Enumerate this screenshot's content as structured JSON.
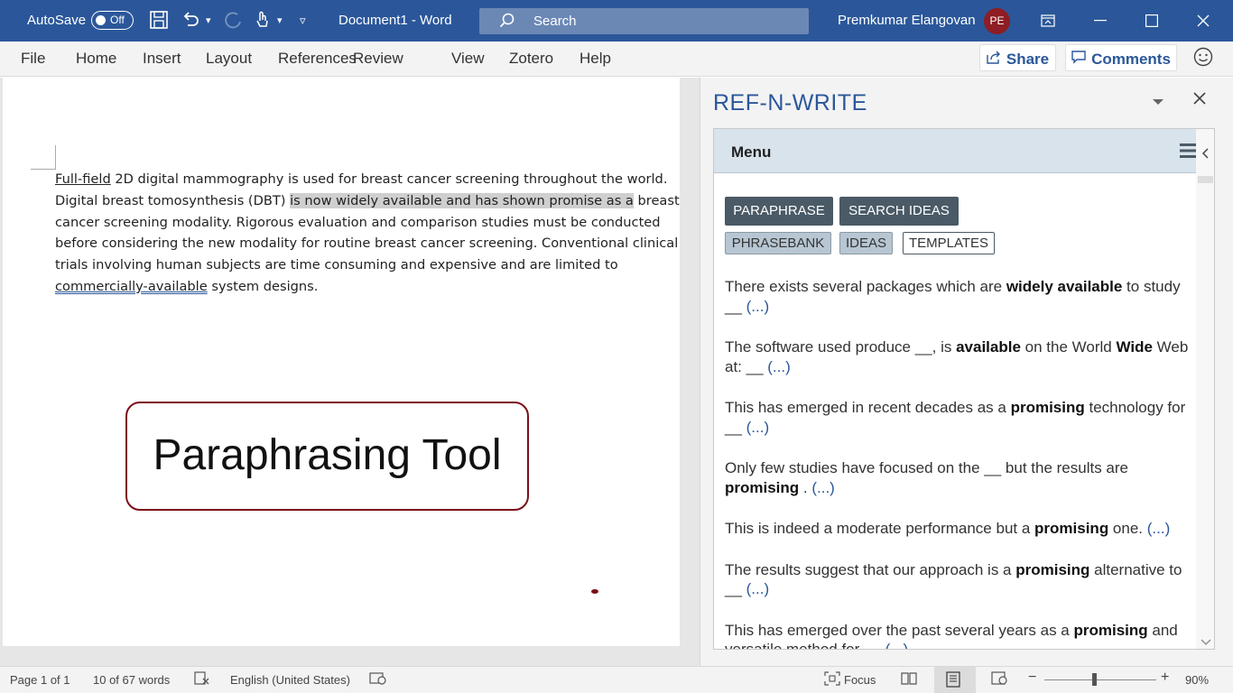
{
  "titlebar": {
    "autosave_label": "AutoSave",
    "autosave_state": "Off",
    "document_title": "Document1  -  Word",
    "search_placeholder": "Search",
    "user_name": "Premkumar Elangovan",
    "user_initials": "PE",
    "accent_color": "#2b579a"
  },
  "ribbon": {
    "tabs": [
      "File",
      "Home",
      "Insert",
      "Layout",
      "References",
      "Review",
      "View",
      "Zotero",
      "Help"
    ],
    "share_label": "Share",
    "comments_label": "Comments"
  },
  "document": {
    "p1_link1": "Full-field",
    "p1_text1": " 2D digital mammography is used for breast cancer screening throughout the world. Digital breast tomosynthesis (DBT) ",
    "p1_highlight": "is now widely available and has shown promise as a",
    "p1_text2": " breast cancer screening modality. Rigorous evaluation and comparison studies must be conducted before considering the new modality for routine breast cancer screening. Conventional clinical trials involving human subjects are time consuming and expensive and are limited to ",
    "p1_link2": "commercially-available",
    "p1_text3": " system designs.",
    "callout_text": "Paraphrasing Tool"
  },
  "pane": {
    "title": "REF-N-WRITE",
    "menu_label": "Menu",
    "buttons": [
      "PARAPHRASE",
      "SEARCH IDEAS"
    ],
    "tags": [
      "PHRASEBANK",
      "IDEAS",
      "TEMPLATES"
    ],
    "results": [
      {
        "parts": [
          [
            "There exists several packages which are ",
            false
          ],
          [
            "widely available",
            true
          ],
          [
            " to study __ ",
            false
          ],
          [
            "(...)",
            "more"
          ]
        ]
      },
      {
        "parts": [
          [
            "The software used produce __, is ",
            false
          ],
          [
            "available",
            true
          ],
          [
            " on the World ",
            false
          ],
          [
            "Wide",
            true
          ],
          [
            " Web at: __ ",
            false
          ],
          [
            "(...)",
            "more"
          ]
        ]
      },
      {
        "parts": [
          [
            "This has emerged in recent decades as a ",
            false
          ],
          [
            "promising",
            true
          ],
          [
            " technology for __ ",
            false
          ],
          [
            "(...)",
            "more"
          ]
        ]
      },
      {
        "parts": [
          [
            "Only few studies have focused on the __ but the results are ",
            false
          ],
          [
            "promising",
            true
          ],
          [
            " . ",
            false
          ],
          [
            "(...)",
            "more"
          ]
        ]
      },
      {
        "parts": [
          [
            "This is indeed a moderate performance but a ",
            false
          ],
          [
            "promising",
            true
          ],
          [
            " one. ",
            false
          ],
          [
            "(...)",
            "more"
          ]
        ]
      },
      {
        "parts": [
          [
            "The results suggest that our approach is a ",
            false
          ],
          [
            "promising",
            true
          ],
          [
            " alternative to __ ",
            false
          ],
          [
            "(...)",
            "more"
          ]
        ]
      },
      {
        "parts": [
          [
            "This has emerged over the past several years as a ",
            false
          ],
          [
            "promising",
            true
          ],
          [
            " and versatile method for __ ",
            false
          ],
          [
            "(...)",
            "more"
          ]
        ]
      }
    ]
  },
  "statusbar": {
    "page": "Page 1 of 1",
    "words": "10 of 67 words",
    "language": "English (United States)",
    "focus_label": "Focus",
    "zoom": "90%",
    "zoom_percent": 90
  }
}
